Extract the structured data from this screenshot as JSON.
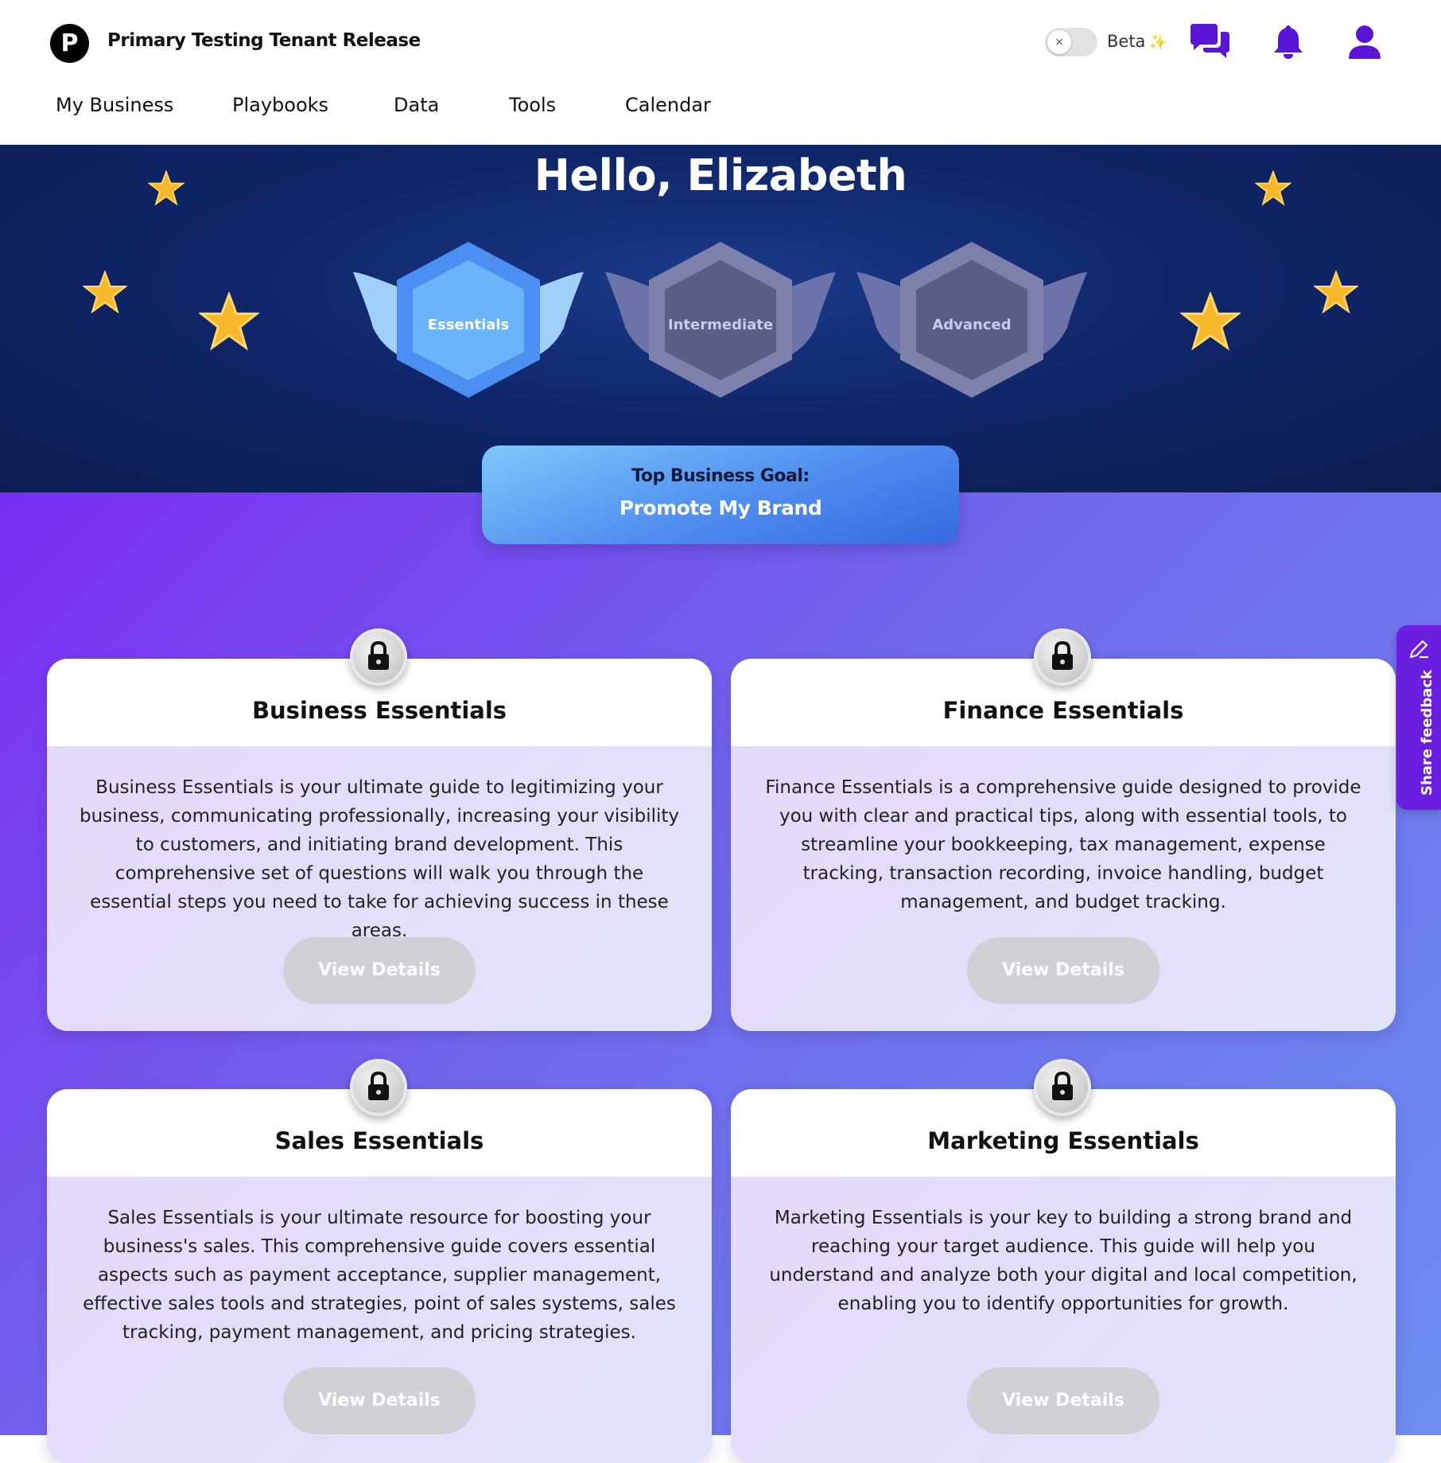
{
  "header": {
    "logo_letter": "P",
    "tenant_name": "Primary Testing Tenant Release",
    "beta_toggle": {
      "label": "Beta",
      "sparkle": "✨",
      "state": "off",
      "off_symbol": "×"
    },
    "icons": [
      "chat-icon",
      "bell-icon",
      "user-icon"
    ],
    "accent_color": "#5b14d6"
  },
  "nav": {
    "items": [
      {
        "label": "My Business"
      },
      {
        "label": "Playbooks"
      },
      {
        "label": "Data"
      },
      {
        "label": "Tools"
      },
      {
        "label": "Calendar"
      }
    ]
  },
  "hero": {
    "greeting": "Hello, Elizabeth",
    "levels": [
      {
        "label": "Essentials",
        "state": "active"
      },
      {
        "label": "Intermediate",
        "state": "locked"
      },
      {
        "label": "Advanced",
        "state": "locked"
      }
    ]
  },
  "goal": {
    "title": "Top Business Goal:",
    "value": "Promote My Brand"
  },
  "cards": [
    {
      "title": "Business Essentials",
      "description": "Business Essentials is your ultimate guide to legitimizing your business, communicating professionally, increasing your visibility to customers, and initiating brand development. This comprehensive set of questions will walk you through the essential steps you need to take for achieving success in these areas.",
      "button": "View Details",
      "locked": true
    },
    {
      "title": "Finance Essentials",
      "description": "Finance Essentials is a comprehensive guide designed to provide you with clear and practical tips, along with essential tools, to streamline your bookkeeping, tax management, expense tracking, transaction recording, invoice handling, budget management, and budget tracking.",
      "button": "View Details",
      "locked": true
    },
    {
      "title": "Sales Essentials",
      "description": "Sales Essentials is your ultimate resource for boosting your business's sales. This comprehensive guide covers essential aspects such as payment acceptance, supplier management, effective sales tools and strategies, point of sales systems, sales tracking, payment management, and pricing strategies.",
      "button": "View Details",
      "locked": true
    },
    {
      "title": "Marketing Essentials",
      "description": "Marketing Essentials is your key to building a strong brand and reaching your target audience. This guide will help you understand and analyze both your digital and local competition, enabling you to identify opportunities for growth.",
      "button": "View Details",
      "locked": true
    }
  ],
  "feedback": {
    "label": "Share feedback"
  },
  "colors": {
    "hero_bg": "#10266a",
    "main_gradient_start": "#7a2cf2",
    "main_gradient_end": "#6d8ef0",
    "goal_blue": "#4f8ef0",
    "feedback_purple": "#6a1fe0",
    "button_disabled": "#d0d0d6"
  }
}
